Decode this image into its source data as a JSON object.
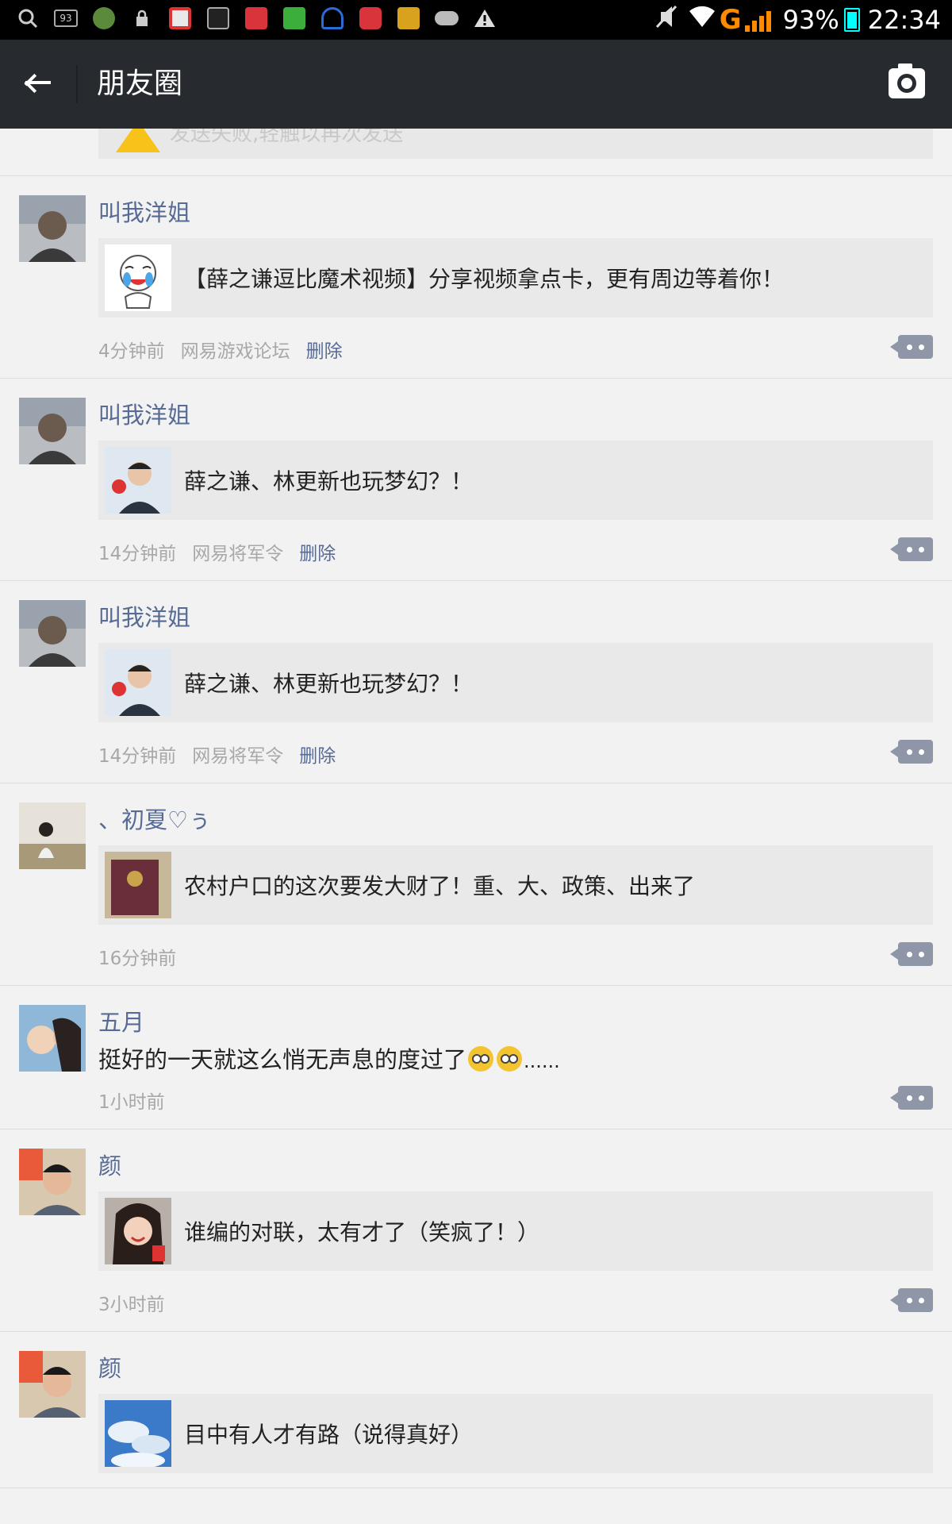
{
  "status_bar": {
    "battery": "93%",
    "time": "22:34",
    "network": "G",
    "notif_badge": "93"
  },
  "nav": {
    "title": "朋友圈"
  },
  "partial_post": {
    "text": "发送失败,轻触以再次发送"
  },
  "posts": [
    {
      "user": "叫我洋姐",
      "share_title": "【薛之谦逗比魔术视频】分享视频拿点卡，更有周边等着你！",
      "time": "4分钟前",
      "source": "网易游戏论坛",
      "delete": "删除"
    },
    {
      "user": "叫我洋姐",
      "share_title": "薛之谦、林更新也玩梦幻？！",
      "time": "14分钟前",
      "source": "网易将军令",
      "delete": "删除"
    },
    {
      "user": "叫我洋姐",
      "share_title": "薛之谦、林更新也玩梦幻？！",
      "time": "14分钟前",
      "source": "网易将军令",
      "delete": "删除"
    },
    {
      "user": "、初夏♡ぅ",
      "share_title": "农村户口的这次要发大财了！重、大、政策、出来了",
      "time": "16分钟前"
    },
    {
      "user": "五月",
      "text": "挺好的一天就这么悄无声息的度过了",
      "text_suffix": "......",
      "time": "1小时前"
    },
    {
      "user": "颜",
      "share_title": "谁编的对联，太有才了（笑疯了！）",
      "time": "3小时前"
    },
    {
      "user": "颜",
      "share_title": "目中有人才有路（说得真好）"
    }
  ]
}
